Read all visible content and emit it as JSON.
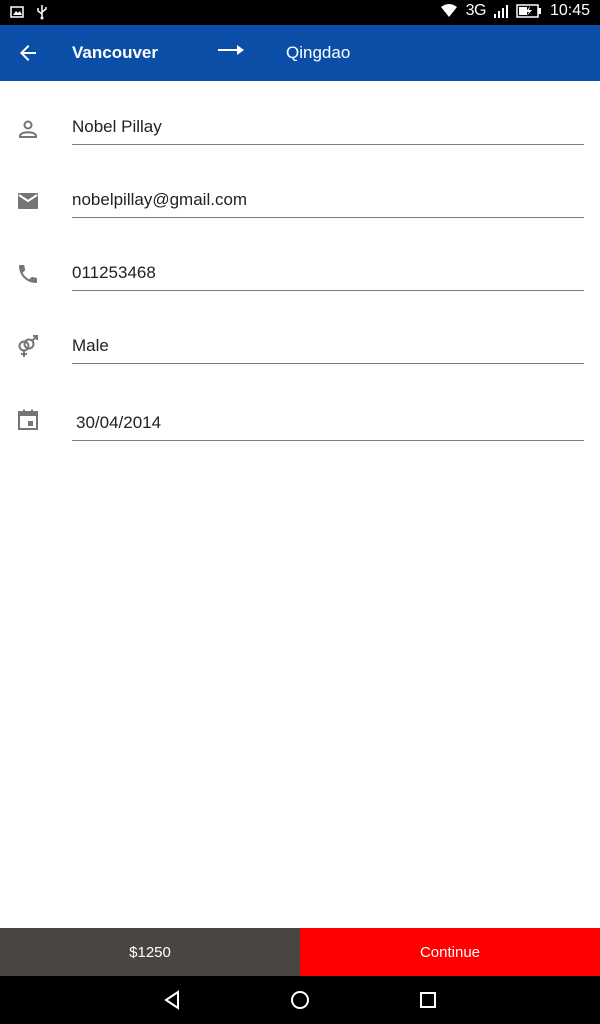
{
  "status_bar": {
    "network": "3G",
    "time": "10:45",
    "icons": [
      "image-icon",
      "usb-icon",
      "wifi-icon",
      "signal-icon",
      "battery-charging-icon"
    ]
  },
  "app_bar": {
    "origin": "Vancouver",
    "destination": "Qingdao",
    "icons": [
      "back-arrow-icon",
      "route-arrow-icon"
    ]
  },
  "form": {
    "name": "Nobel Pillay",
    "email": "nobelpillay@gmail.com",
    "phone": "011253468",
    "gender": "Male",
    "date": "30/04/2014",
    "icons": [
      "person-icon",
      "email-icon",
      "phone-icon",
      "gender-icon",
      "calendar-icon"
    ]
  },
  "bottom_bar": {
    "price": "$1250",
    "continue_label": "Continue"
  },
  "nav_bar": {
    "icons": [
      "back-triangle-icon",
      "home-circle-icon",
      "recents-square-icon"
    ]
  },
  "colors": {
    "app_bar": "#0a4ea8",
    "continue": "#ff0000",
    "price_bar": "#4a4543",
    "icon_gray": "#757575"
  }
}
